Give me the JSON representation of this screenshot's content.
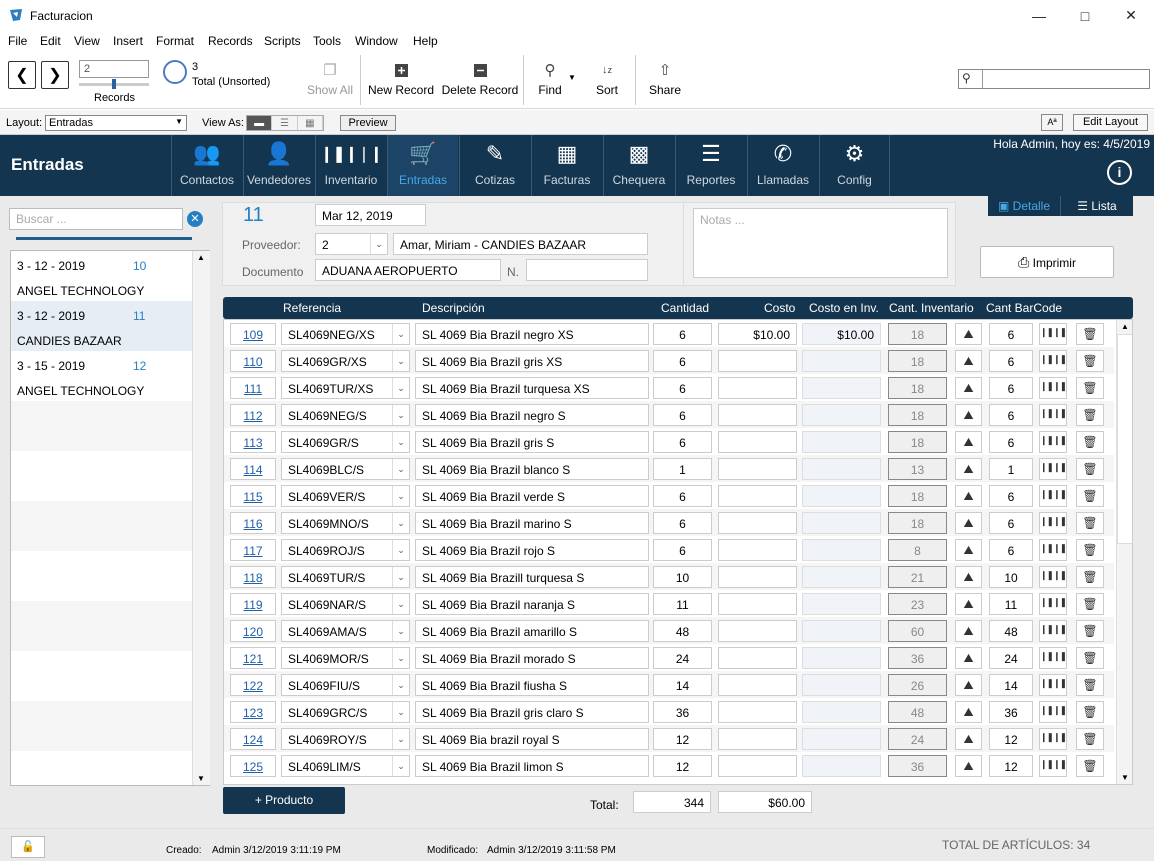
{
  "window": {
    "title": "Facturacion"
  },
  "menu": [
    "File",
    "Edit",
    "View",
    "Insert",
    "Format",
    "Records",
    "Scripts",
    "Tools",
    "Window",
    "Help"
  ],
  "toolbar": {
    "record_value": "2",
    "records_label": "Records",
    "total_count": "3",
    "total_label": "Total (Unsorted)",
    "show_all": "Show All",
    "new_record": "New Record",
    "delete_record": "Delete Record",
    "find": "Find",
    "sort": "Sort",
    "share": "Share"
  },
  "layoutbar": {
    "layout_label": "Layout:",
    "layout_value": "Entradas",
    "view_as_label": "View As:",
    "preview": "Preview",
    "aa": "Aª",
    "edit_layout": "Edit Layout"
  },
  "nav": {
    "section": "Entradas",
    "greeting": "Hola Admin, hoy es: 4/5/2019",
    "tabs": [
      {
        "label": "Contactos",
        "icon": "contacts-icon"
      },
      {
        "label": "Vendedores",
        "icon": "person-icon"
      },
      {
        "label": "Inventario",
        "icon": "barcode-icon"
      },
      {
        "label": "Entradas",
        "icon": "cart-icon"
      },
      {
        "label": "Cotizas",
        "icon": "edit-icon"
      },
      {
        "label": "Facturas",
        "icon": "invoice-icon"
      },
      {
        "label": "Chequera",
        "icon": "checkbook-icon"
      },
      {
        "label": "Reportes",
        "icon": "reports-icon"
      },
      {
        "label": "Llamadas",
        "icon": "phone-icon"
      },
      {
        "label": "Config",
        "icon": "gear-icon"
      }
    ]
  },
  "left": {
    "search_placeholder": "Buscar ...",
    "records": [
      {
        "date": "3 - 12 - 2019",
        "num": "10",
        "company": "ANGEL TECHNOLOGY"
      },
      {
        "date": "3 - 12 - 2019",
        "num": "11",
        "company": "CANDIES BAZAAR"
      },
      {
        "date": "3 - 15 - 2019",
        "num": "12",
        "company": "ANGEL TECHNOLOGY"
      }
    ]
  },
  "header": {
    "number": "11",
    "date": "Mar 12, 2019",
    "proveedor_label": "Proveedor:",
    "proveedor_id": "2",
    "proveedor_name": "Amar, Miriam - CANDIES BAZAAR",
    "documento_label": "Documento",
    "documento": "ADUANA AEROPUERTO",
    "n_label": "N.",
    "n_value": "",
    "notes_placeholder": "Notas ...",
    "view_detalle": "Detalle",
    "view_lista": "Lista",
    "print": "Imprimir"
  },
  "table": {
    "columns": {
      "referencia": "Referencia",
      "descripcion": "Descripción",
      "cantidad": "Cantidad",
      "costo": "Costo",
      "costo_inv": "Costo en Inv.",
      "cant_inv": "Cant. Inventario",
      "cant_barcode": "Cant BarCode"
    },
    "rows": [
      {
        "id": "109",
        "ref": "SL4069NEG/XS",
        "desc": "SL 4069 Bia Brazil negro XS",
        "qty": "6",
        "cost": "$10.00",
        "cost_inv": "$10.00",
        "inv": "18",
        "bc": "6"
      },
      {
        "id": "110",
        "ref": "SL4069GR/XS",
        "desc": "SL 4069 Bia Brazil gris XS",
        "qty": "6",
        "cost": "",
        "cost_inv": "",
        "inv": "18",
        "bc": "6"
      },
      {
        "id": "111",
        "ref": "SL4069TUR/XS",
        "desc": "SL 4069 Bia Brazil turquesa XS",
        "qty": "6",
        "cost": "",
        "cost_inv": "",
        "inv": "18",
        "bc": "6"
      },
      {
        "id": "112",
        "ref": "SL4069NEG/S",
        "desc": "SL 4069 Bia Brazil negro S",
        "qty": "6",
        "cost": "",
        "cost_inv": "",
        "inv": "18",
        "bc": "6"
      },
      {
        "id": "113",
        "ref": "SL4069GR/S",
        "desc": "SL 4069 Bia Brazil gris S",
        "qty": "6",
        "cost": "",
        "cost_inv": "",
        "inv": "18",
        "bc": "6"
      },
      {
        "id": "114",
        "ref": "SL4069BLC/S",
        "desc": "SL 4069 Bia Brazil blanco S",
        "qty": "1",
        "cost": "",
        "cost_inv": "",
        "inv": "13",
        "bc": "1"
      },
      {
        "id": "115",
        "ref": "SL4069VER/S",
        "desc": "SL 4069 Bia Brazil verde S",
        "qty": "6",
        "cost": "",
        "cost_inv": "",
        "inv": "18",
        "bc": "6"
      },
      {
        "id": "116",
        "ref": "SL4069MNO/S",
        "desc": "SL 4069 Bia Brazil marino S",
        "qty": "6",
        "cost": "",
        "cost_inv": "",
        "inv": "18",
        "bc": "6"
      },
      {
        "id": "117",
        "ref": "SL4069ROJ/S",
        "desc": "SL 4069 Bia Brazil rojo S",
        "qty": "6",
        "cost": "",
        "cost_inv": "",
        "inv": "8",
        "bc": "6"
      },
      {
        "id": "118",
        "ref": "SL4069TUR/S",
        "desc": "SL 4069 Bia Brazill turquesa S",
        "qty": "10",
        "cost": "",
        "cost_inv": "",
        "inv": "21",
        "bc": "10"
      },
      {
        "id": "119",
        "ref": "SL4069NAR/S",
        "desc": "SL 4069 Bia Brazil naranja S",
        "qty": "11",
        "cost": "",
        "cost_inv": "",
        "inv": "23",
        "bc": "11"
      },
      {
        "id": "120",
        "ref": "SL4069AMA/S",
        "desc": "SL 4069 Bia Brazil amarillo S",
        "qty": "48",
        "cost": "",
        "cost_inv": "",
        "inv": "60",
        "bc": "48"
      },
      {
        "id": "121",
        "ref": "SL4069MOR/S",
        "desc": "SL 4069 Bia Brazil morado S",
        "qty": "24",
        "cost": "",
        "cost_inv": "",
        "inv": "36",
        "bc": "24"
      },
      {
        "id": "122",
        "ref": "SL4069FIU/S",
        "desc": "SL 4069 Bia Brazil fiusha S",
        "qty": "14",
        "cost": "",
        "cost_inv": "",
        "inv": "26",
        "bc": "14"
      },
      {
        "id": "123",
        "ref": "SL4069GRC/S",
        "desc": "SL 4069 Bia Brazil gris claro S",
        "qty": "36",
        "cost": "",
        "cost_inv": "",
        "inv": "48",
        "bc": "36"
      },
      {
        "id": "124",
        "ref": "SL4069ROY/S",
        "desc": "SL 4069 Bia brazil royal S",
        "qty": "12",
        "cost": "",
        "cost_inv": "",
        "inv": "24",
        "bc": "12"
      },
      {
        "id": "125",
        "ref": "SL4069LIM/S",
        "desc": "SL 4069 Bia Brazil limon S",
        "qty": "12",
        "cost": "",
        "cost_inv": "",
        "inv": "36",
        "bc": "12"
      }
    ],
    "add_product": "+ Producto",
    "total_label": "Total:",
    "total_qty": "344",
    "total_cost": "$60.00"
  },
  "footer": {
    "creado_label": "Creado:",
    "creado_value": "Admin  3/12/2019 3:11:19 PM",
    "modificado_label": "Modificado:",
    "modificado_value": "Admin  3/12/2019 3:11:58 PM",
    "total_items": "TOTAL DE ARTÍCULOS: 34"
  },
  "colors": {
    "header_bg": "#14354f",
    "accent": "#2580c3",
    "active_tab": "#47a7e8"
  }
}
